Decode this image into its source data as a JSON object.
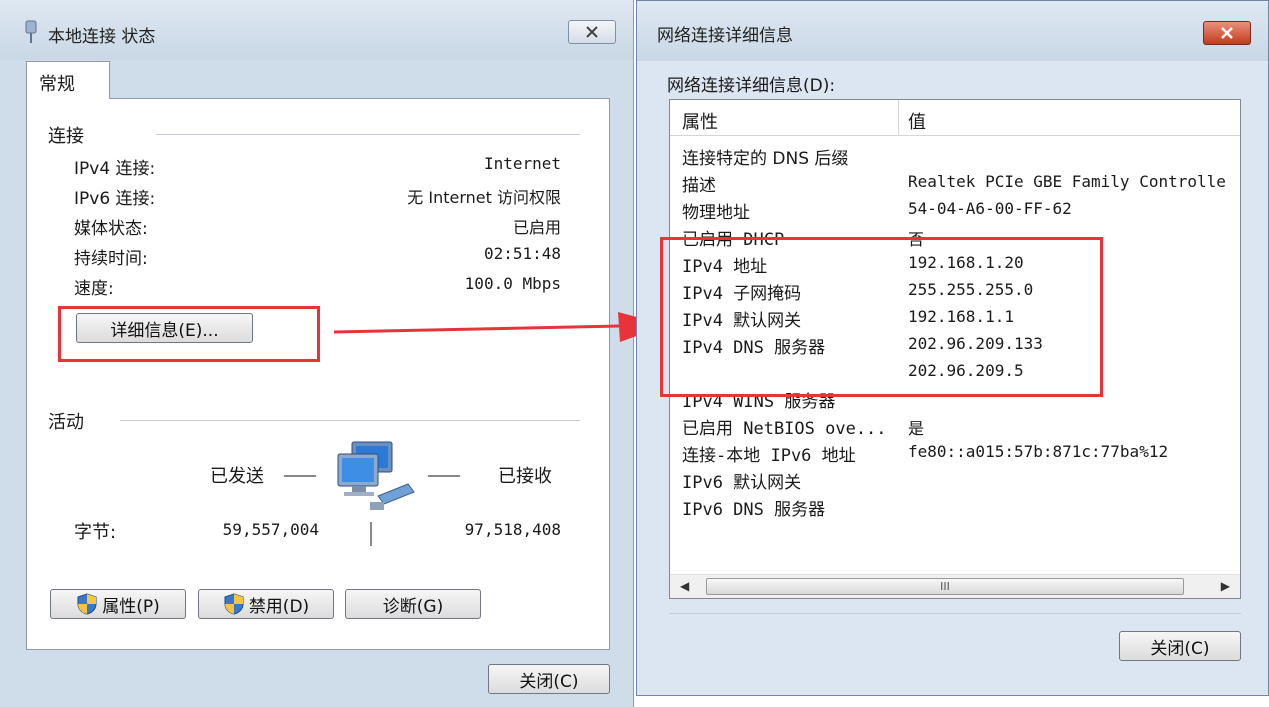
{
  "left_dialog": {
    "title": "本地连接 状态",
    "tab": "常规",
    "connection_section": "连接",
    "rows": [
      {
        "label": "IPv4 连接:",
        "value": "Internet"
      },
      {
        "label": "IPv6 连接:",
        "value": "无 Internet 访问权限"
      },
      {
        "label": "媒体状态:",
        "value": "已启用"
      },
      {
        "label": "持续时间:",
        "value": "02:51:48"
      },
      {
        "label": "速度:",
        "value": "100.0 Mbps"
      }
    ],
    "details_button": "详细信息(E)...",
    "activity_section": "活动",
    "sent_label": "已发送",
    "received_label": "已接收",
    "bytes_label": "字节:",
    "bytes_sent": "59,557,004",
    "bytes_received": "97,518,408",
    "properties_button": "属性(P)",
    "disable_button": "禁用(D)",
    "diagnose_button": "诊断(G)",
    "close_button": "关闭(C)"
  },
  "right_dialog": {
    "title": "网络连接详细信息",
    "list_label": "网络连接详细信息(D):",
    "col_property": "属性",
    "col_value": "值",
    "rows": [
      {
        "prop": "连接特定的 DNS 后缀",
        "val": ""
      },
      {
        "prop": "描述",
        "val": "Realtek PCIe GBE Family Controlle"
      },
      {
        "prop": "物理地址",
        "val": "54-04-A6-00-FF-62"
      },
      {
        "prop": "已启用 DHCP",
        "val": "否"
      },
      {
        "prop": "IPv4 地址",
        "val": "192.168.1.20"
      },
      {
        "prop": "IPv4 子网掩码",
        "val": "255.255.255.0"
      },
      {
        "prop": "IPv4 默认网关",
        "val": "192.168.1.1"
      },
      {
        "prop": "IPv4 DNS 服务器",
        "val": "202.96.209.133"
      },
      {
        "prop": "",
        "val": "202.96.209.5"
      },
      {
        "prop": "IPv4 WINS 服务器",
        "val": ""
      },
      {
        "prop": "已启用 NetBIOS ove...",
        "val": "是"
      },
      {
        "prop": "连接-本地 IPv6 地址",
        "val": "fe80::a015:57b:871c:77ba%12"
      },
      {
        "prop": "IPv6 默认网关",
        "val": ""
      },
      {
        "prop": "IPv6 DNS 服务器",
        "val": ""
      }
    ],
    "scroll_thumb_grip": "III",
    "close_button": "关闭(C)"
  },
  "colors": {
    "highlight": "#e8333a",
    "dialog_bg": "#cfdcea",
    "close_red": "#c43b1e"
  }
}
